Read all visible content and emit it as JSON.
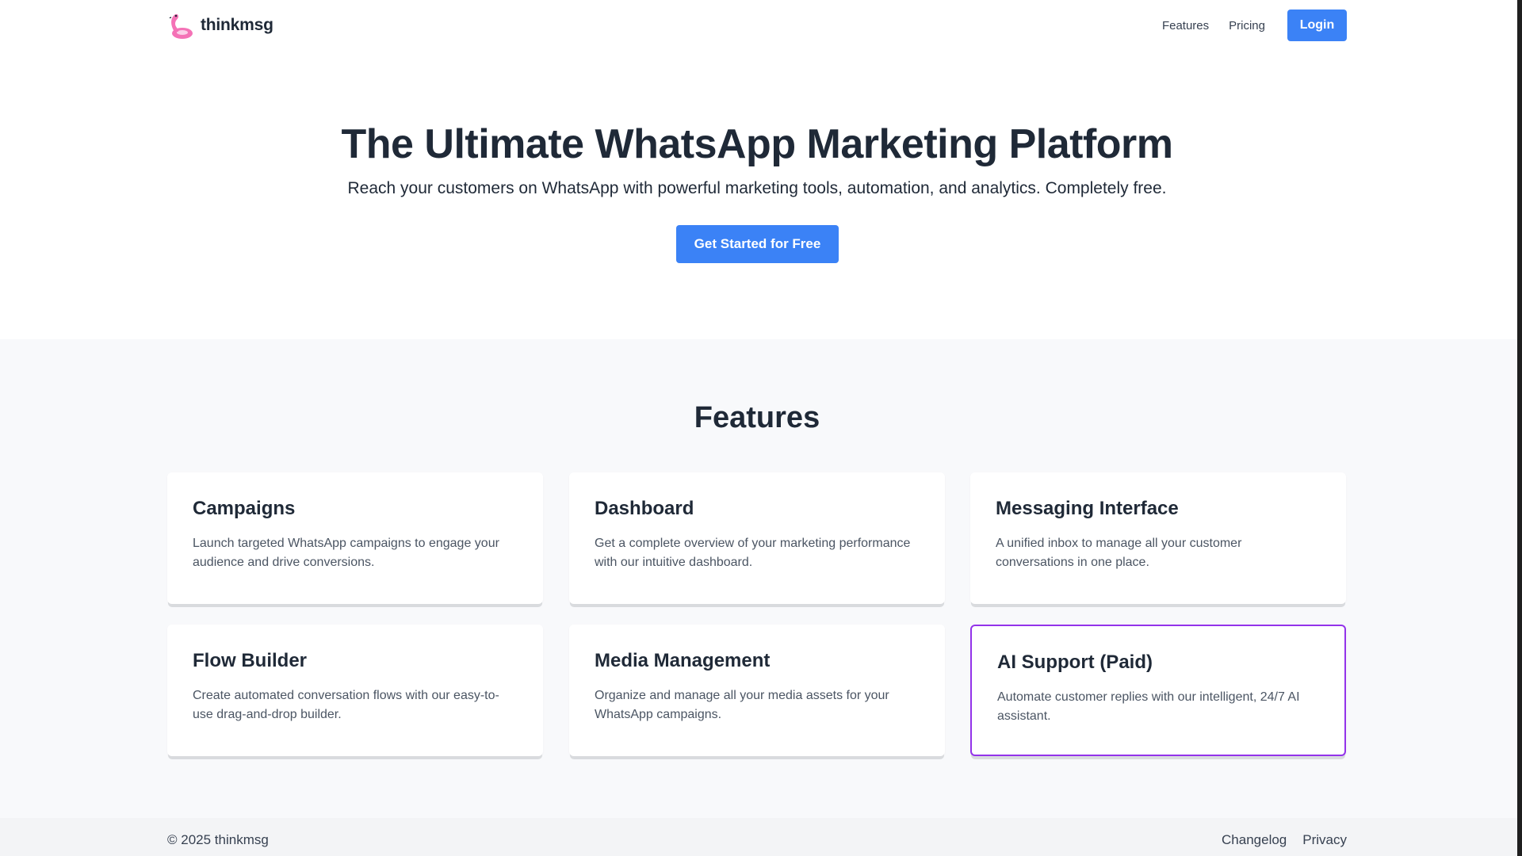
{
  "header": {
    "brand": "thinkmsg",
    "nav": {
      "features": "Features",
      "pricing": "Pricing",
      "login": "Login"
    }
  },
  "hero": {
    "title": "The Ultimate WhatsApp Marketing Platform",
    "subtitle": "Reach your customers on WhatsApp with powerful marketing tools, automation, and analytics. Completely free.",
    "cta": "Get Started for Free"
  },
  "features": {
    "title": "Features",
    "cards": [
      {
        "title": "Campaigns",
        "desc": "Launch targeted WhatsApp campaigns to engage your audience and drive conversions."
      },
      {
        "title": "Dashboard",
        "desc": "Get a complete overview of your marketing performance with our intuitive dashboard."
      },
      {
        "title": "Messaging Interface",
        "desc": "A unified inbox to manage all your customer conversations in one place."
      },
      {
        "title": "Flow Builder",
        "desc": "Create automated conversation flows with our easy-to-use drag-and-drop builder."
      },
      {
        "title": "Media Management",
        "desc": "Organize and manage all your media assets for your WhatsApp campaigns."
      },
      {
        "title": "AI Support (Paid)",
        "desc": "Automate customer replies with our intelligent, 24/7 AI assistant."
      }
    ]
  },
  "footer": {
    "copyright": "© 2025 thinkmsg",
    "links": {
      "changelog": "Changelog",
      "privacy": "Privacy"
    }
  },
  "colors": {
    "accent": "#3b82f6",
    "highlight_border": "#9333ea",
    "text_dark": "#1f2937",
    "features_bg": "#f8f9fb"
  }
}
